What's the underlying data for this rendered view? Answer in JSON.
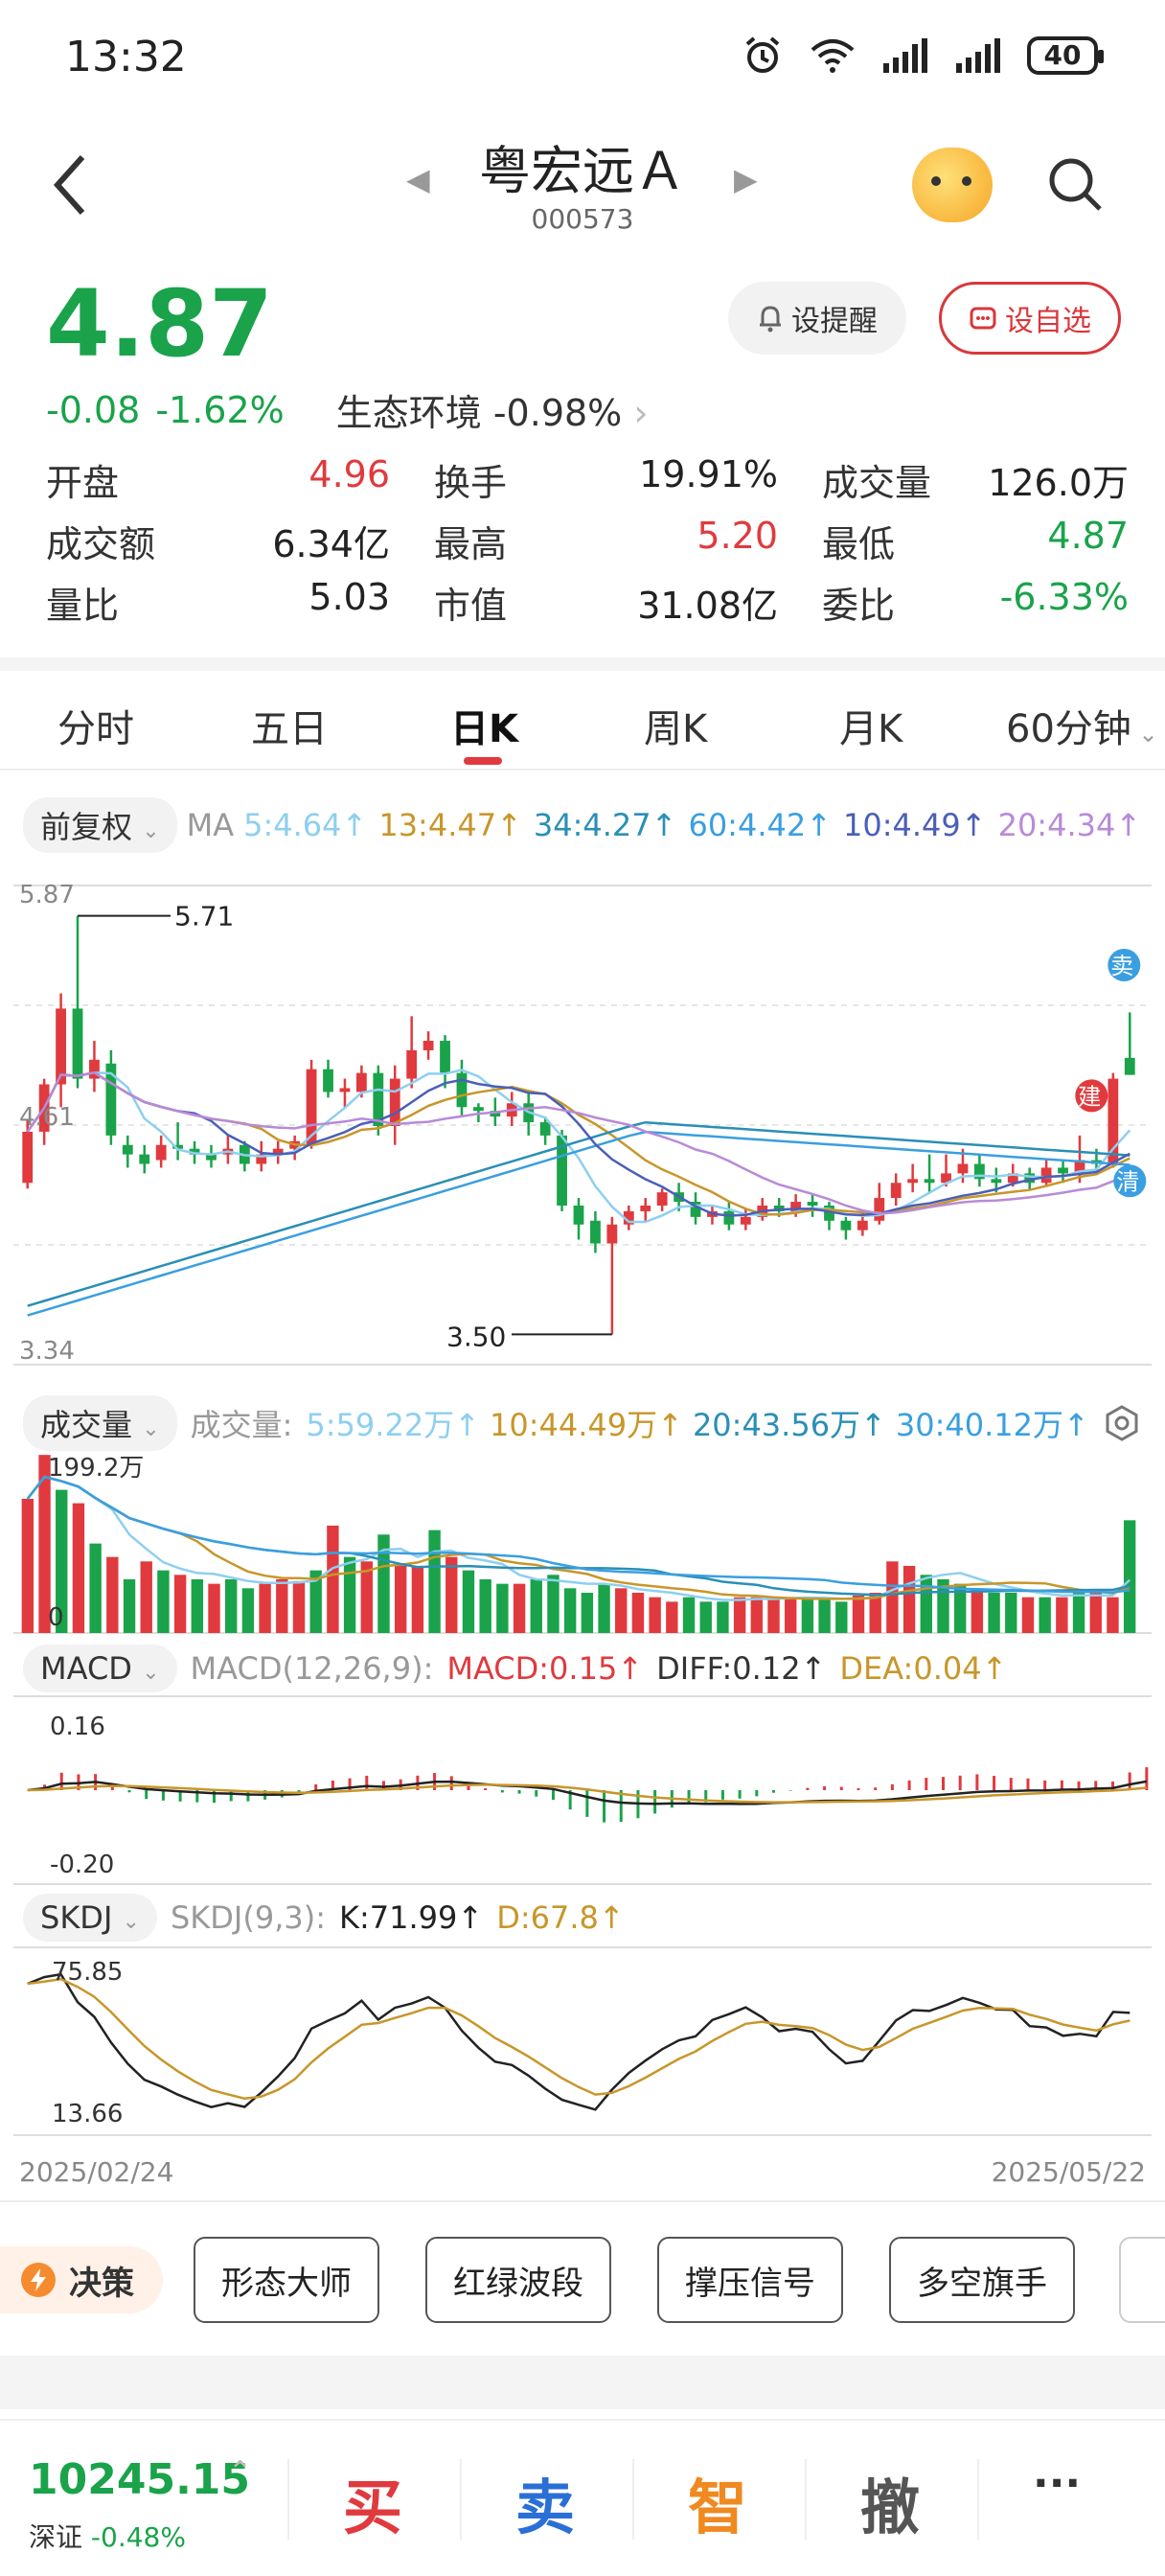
{
  "status_bar": {
    "time": "13:32",
    "battery": "40"
  },
  "header": {
    "title": "粤宏远Ａ",
    "code": "000573"
  },
  "quote": {
    "price": "4.87",
    "change": "-0.08",
    "change_pct": "-1.62%",
    "sector": "生态环境 -0.98%",
    "remind_label": "设提醒",
    "fav_label": "设自选",
    "colors": {
      "up": "#e03a3e",
      "down": "#1aa34a"
    }
  },
  "stats": [
    [
      {
        "label": "开盘",
        "value": "4.96",
        "color": "red"
      },
      {
        "label": "换手",
        "value": "19.91%",
        "color": ""
      },
      {
        "label": "成交量",
        "value": "126.0万",
        "color": ""
      }
    ],
    [
      {
        "label": "成交额",
        "value": "6.34亿",
        "color": ""
      },
      {
        "label": "最高",
        "value": "5.20",
        "color": "red"
      },
      {
        "label": "最低",
        "value": "4.87",
        "color": "green"
      }
    ],
    [
      {
        "label": "量比",
        "value": "5.03",
        "color": ""
      },
      {
        "label": "市值",
        "value": "31.08亿",
        "color": ""
      },
      {
        "label": "委比",
        "value": "-6.33%",
        "color": "green"
      }
    ]
  ],
  "tabs": [
    "分时",
    "五日",
    "日K",
    "周K",
    "月K",
    "60分钟"
  ],
  "active_tab": "日K",
  "ma": {
    "adjust": "前复权",
    "label": "MA",
    "items": [
      {
        "text": "5:4.64↑",
        "color": "#8ecff0"
      },
      {
        "text": "13:4.47↑",
        "color": "#c8962a"
      },
      {
        "text": "34:4.27↑",
        "color": "#2a8fb6"
      },
      {
        "text": "60:4.42↑",
        "color": "#3a9fe0"
      },
      {
        "text": "10:4.49↑",
        "color": "#4a5fb8"
      },
      {
        "text": "20:4.34↑",
        "color": "#b88ad8"
      }
    ]
  },
  "kline": {
    "y_top": "5.87",
    "y_mid": "4.61",
    "y_bottom": "3.34",
    "high_label": "5.71",
    "low_label": "3.50",
    "sell_marker": "卖",
    "build_marker": "建",
    "clear_marker": "清"
  },
  "volume": {
    "pill": "成交量",
    "label": "成交量:",
    "items": [
      {
        "text": "5:59.22万↑",
        "color": "#8ecff0"
      },
      {
        "text": "10:44.49万↑",
        "color": "#c8962a"
      },
      {
        "text": "20:43.56万↑",
        "color": "#2a8fb6"
      },
      {
        "text": "30:40.12万↑",
        "color": "#3a9fe0"
      }
    ],
    "y_top": "199.2万",
    "y_bottom": "0"
  },
  "macd": {
    "pill": "MACD",
    "params": "MACD(12,26,9):",
    "macd": "MACD:0.15↑",
    "diff": "DIFF:0.12↑",
    "dea": "DEA:0.04↑",
    "y_top": "0.16",
    "y_bottom": "-0.20"
  },
  "skdj": {
    "pill": "SKDJ",
    "params": "SKDJ(9,3):",
    "k": "K:71.99↑",
    "d": "D:67.8↑",
    "y_top": "75.85",
    "y_bottom": "13.66"
  },
  "dates": {
    "start": "2025/02/24",
    "end": "2025/05/22"
  },
  "tools": {
    "decide": "决策",
    "items": [
      "形态大师",
      "红绿波段",
      "撑压信号",
      "多空旗手"
    ]
  },
  "bottom": {
    "index_value": "10245.15",
    "index_name": "深证",
    "index_change": "-0.48%",
    "buy": "买",
    "sell": "卖",
    "smart": "智",
    "cancel": "撤",
    "more": "···"
  },
  "chart_data": {
    "type": "candlestick",
    "series_candles": [
      [
        4.3,
        4.57,
        4.27,
        4.63
      ],
      [
        4.57,
        4.82,
        4.5,
        4.85
      ],
      [
        4.82,
        5.22,
        4.7,
        5.3
      ],
      [
        5.22,
        4.85,
        4.8,
        5.71
      ],
      [
        4.85,
        4.95,
        4.78,
        5.05
      ],
      [
        4.93,
        4.55,
        4.5,
        5.0
      ],
      [
        4.5,
        4.45,
        4.38,
        4.55
      ],
      [
        4.45,
        4.4,
        4.35,
        4.5
      ],
      [
        4.42,
        4.5,
        4.38,
        4.55
      ],
      [
        4.5,
        4.48,
        4.42,
        4.62
      ],
      [
        4.48,
        4.45,
        4.4,
        4.52
      ],
      [
        4.45,
        4.42,
        4.38,
        4.5
      ],
      [
        4.45,
        4.48,
        4.4,
        4.55
      ],
      [
        4.5,
        4.4,
        4.36,
        4.52
      ],
      [
        4.4,
        4.45,
        4.36,
        4.52
      ],
      [
        4.45,
        4.48,
        4.4,
        4.52
      ],
      [
        4.48,
        4.52,
        4.42,
        4.55
      ],
      [
        4.5,
        4.9,
        4.48,
        4.95
      ],
      [
        4.9,
        4.78,
        4.75,
        4.95
      ],
      [
        4.78,
        4.8,
        4.7,
        4.85
      ],
      [
        4.78,
        4.88,
        4.75,
        4.92
      ],
      [
        4.88,
        4.6,
        4.55,
        4.92
      ],
      [
        4.6,
        4.85,
        4.5,
        4.92
      ],
      [
        4.85,
        5.0,
        4.8,
        5.18
      ],
      [
        5.0,
        5.05,
        4.95,
        5.1
      ],
      [
        5.05,
        4.88,
        4.8,
        5.08
      ],
      [
        4.88,
        4.7,
        4.65,
        4.95
      ],
      [
        4.7,
        4.68,
        4.62,
        4.72
      ],
      [
        4.68,
        4.65,
        4.6,
        4.75
      ],
      [
        4.65,
        4.72,
        4.6,
        4.78
      ],
      [
        4.72,
        4.62,
        4.55,
        4.78
      ],
      [
        4.62,
        4.55,
        4.5,
        4.65
      ],
      [
        4.55,
        4.18,
        4.15,
        4.58
      ],
      [
        4.18,
        4.08,
        4.0,
        4.22
      ],
      [
        4.1,
        3.98,
        3.93,
        4.15
      ],
      [
        3.98,
        4.08,
        3.5,
        4.12
      ],
      [
        4.08,
        4.15,
        4.05,
        4.18
      ],
      [
        4.15,
        4.18,
        4.1,
        4.22
      ],
      [
        4.18,
        4.25,
        4.15,
        4.27
      ],
      [
        4.25,
        4.2,
        4.15,
        4.3
      ],
      [
        4.2,
        4.12,
        4.08,
        4.25
      ],
      [
        4.12,
        4.15,
        4.08,
        4.18
      ],
      [
        4.15,
        4.08,
        4.05,
        4.2
      ],
      [
        4.08,
        4.12,
        4.05,
        4.16
      ],
      [
        4.12,
        4.18,
        4.1,
        4.22
      ],
      [
        4.18,
        4.15,
        4.12,
        4.22
      ],
      [
        4.15,
        4.2,
        4.12,
        4.24
      ],
      [
        4.2,
        4.18,
        4.12,
        4.24
      ],
      [
        4.18,
        4.1,
        4.05,
        4.2
      ],
      [
        4.1,
        4.05,
        4.0,
        4.12
      ],
      [
        4.05,
        4.1,
        4.02,
        4.14
      ],
      [
        4.1,
        4.22,
        4.08,
        4.3
      ],
      [
        4.22,
        4.3,
        4.18,
        4.35
      ],
      [
        4.3,
        4.32,
        4.25,
        4.4
      ],
      [
        4.32,
        4.3,
        4.25,
        4.45
      ],
      [
        4.3,
        4.35,
        4.28,
        4.45
      ],
      [
        4.35,
        4.4,
        4.3,
        4.48
      ],
      [
        4.4,
        4.32,
        4.28,
        4.45
      ],
      [
        4.32,
        4.3,
        4.25,
        4.38
      ],
      [
        4.3,
        4.35,
        4.28,
        4.4
      ],
      [
        4.35,
        4.3,
        4.26,
        4.38
      ],
      [
        4.3,
        4.38,
        4.28,
        4.42
      ],
      [
        4.38,
        4.35,
        4.3,
        4.42
      ],
      [
        4.35,
        4.42,
        4.3,
        4.55
      ],
      [
        4.42,
        4.4,
        4.35,
        4.48
      ],
      [
        4.4,
        4.85,
        4.38,
        4.88
      ],
      [
        4.96,
        4.87,
        4.87,
        5.2
      ]
    ],
    "volume": [
      150,
      199,
      160,
      145,
      100,
      85,
      60,
      80,
      70,
      65,
      60,
      55,
      60,
      50,
      55,
      60,
      58,
      70,
      120,
      85,
      80,
      110,
      75,
      75,
      115,
      85,
      70,
      60,
      55,
      55,
      60,
      65,
      50,
      45,
      55,
      50,
      45,
      40,
      35,
      40,
      35,
      35,
      40,
      40,
      40,
      40,
      38,
      38,
      35,
      42,
      45,
      80,
      75,
      65,
      60,
      55,
      50,
      45,
      45,
      40,
      40,
      40,
      45,
      45,
      40,
      126
    ],
    "volume_up": [
      true,
      true,
      false,
      true,
      false,
      true,
      false,
      true,
      false,
      true,
      false,
      true,
      false,
      false,
      true,
      true,
      true,
      false,
      true,
      false,
      true,
      false,
      true,
      true,
      false,
      true,
      false,
      false,
      false,
      true,
      false,
      false,
      false,
      false,
      false,
      true,
      true,
      true,
      true,
      false,
      false,
      false,
      true,
      true,
      true,
      true,
      false,
      false,
      false,
      true,
      true,
      true,
      true,
      false,
      false,
      false,
      true,
      false,
      false,
      true,
      false,
      true,
      false,
      true,
      true,
      false
    ],
    "ylim": [
      3.34,
      5.87
    ]
  }
}
